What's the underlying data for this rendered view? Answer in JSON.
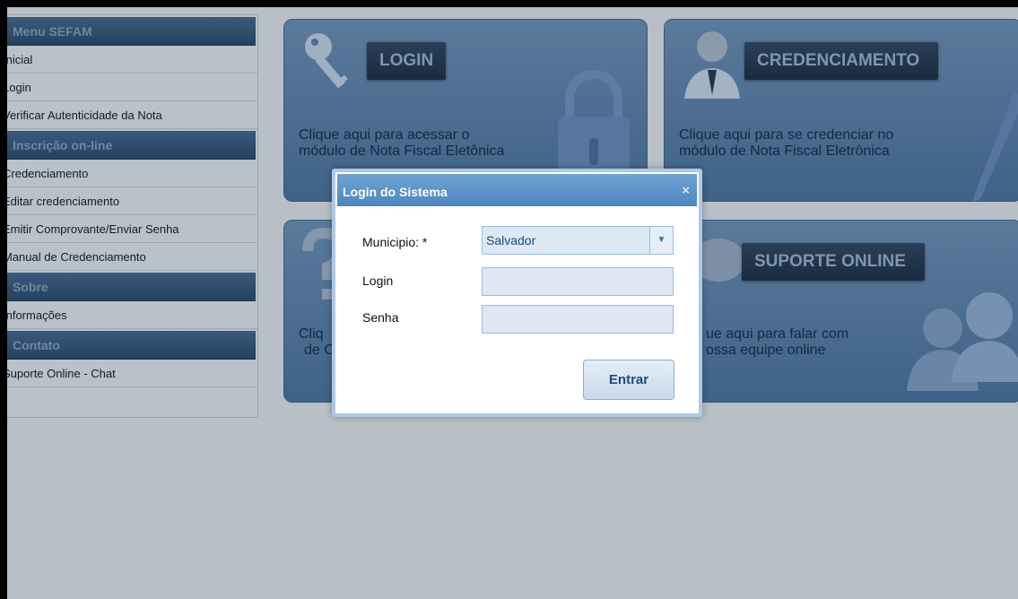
{
  "sidebar": {
    "sections": [
      {
        "title": "Menu SEFAM",
        "items": [
          "Inicial",
          "Login",
          "Verificar Autenticidade da Nota"
        ]
      },
      {
        "title": "Inscrição on-line",
        "items": [
          "Credenciamento",
          "Editar credenciamento",
          "Emitir Comprovante/Enviar Senha",
          "Manual de Credenciamento"
        ]
      },
      {
        "title": "Sobre",
        "items": [
          "Informações"
        ]
      },
      {
        "title": "Contato",
        "items": [
          "Suporte Online - Chat"
        ]
      }
    ]
  },
  "tiles": {
    "login": {
      "title": "LOGIN",
      "desc1": "Clique aqui para acessar o",
      "desc2": "módulo de Nota Fiscal Eletônica",
      "icon": "key-icon"
    },
    "credenciamento": {
      "title": "CREDENCIAMENTO",
      "desc1": "Clique aqui para se credenciar no",
      "desc2": "módulo de Nota Fiscal Eletrônica",
      "icon": "person-icon"
    },
    "ajuda": {
      "desc1": "Cliq",
      "desc2": "de C",
      "icon": "question-icon"
    },
    "suporte": {
      "title": "SUPORTE ONLINE",
      "desc1": "ue aqui para falar com",
      "desc2": "ossa equipe online",
      "icon": "chat-icon"
    }
  },
  "dialog": {
    "title": "Login do Sistema",
    "close_label": "×",
    "municipio_label": "Municipio: *",
    "municipio_value": "Salvador",
    "login_label": "Login",
    "login_value": "",
    "senha_label": "Senha",
    "senha_value": "",
    "submit_label": "Entrar"
  },
  "colors": {
    "accent": "#4d86bf",
    "overlay": "#b8bfc7",
    "tile": "#4a6c91"
  }
}
